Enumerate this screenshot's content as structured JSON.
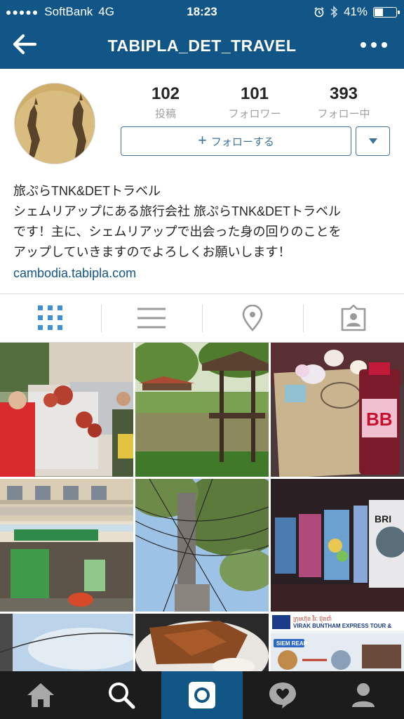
{
  "status_bar": {
    "signal_dots": "●●●●●",
    "carrier": "SoftBank",
    "network": "4G",
    "time": "18:23",
    "battery": "41%",
    "battery_level": 0.41
  },
  "header": {
    "title": "TABIPLA_DET_TRAVEL"
  },
  "profile": {
    "stats": [
      {
        "value": "102",
        "label": "投稿"
      },
      {
        "value": "101",
        "label": "フォロワー"
      },
      {
        "value": "393",
        "label": "フォロー中"
      }
    ],
    "follow_button": "フォローする",
    "bio": {
      "name": "旅ぷらTNK&DETトラベル",
      "lines": [
        "シェムリアップにある旅行会社 旅ぷらTNK&DETトラベル",
        "です！主に、シェムリアップで出会った身の回りのことを",
        "アップしていきますのでよろしくお願いします！"
      ],
      "link": "cambodia.tabipla.com"
    }
  },
  "tabs": [
    {
      "icon": "grid-icon",
      "active": true
    },
    {
      "icon": "list-icon",
      "active": false
    },
    {
      "icon": "location-pin-icon",
      "active": false
    },
    {
      "icon": "tagged-person-icon",
      "active": false
    }
  ],
  "bottom_nav": [
    {
      "icon": "home-icon"
    },
    {
      "icon": "search-icon"
    },
    {
      "icon": "camera-icon",
      "active": true
    },
    {
      "icon": "activity-heart-icon"
    },
    {
      "icon": "profile-icon"
    }
  ],
  "colors": {
    "header_bg": "#125688",
    "accent": "#3f729b",
    "link": "#125688",
    "nav_bg": "#1c1c1c"
  }
}
